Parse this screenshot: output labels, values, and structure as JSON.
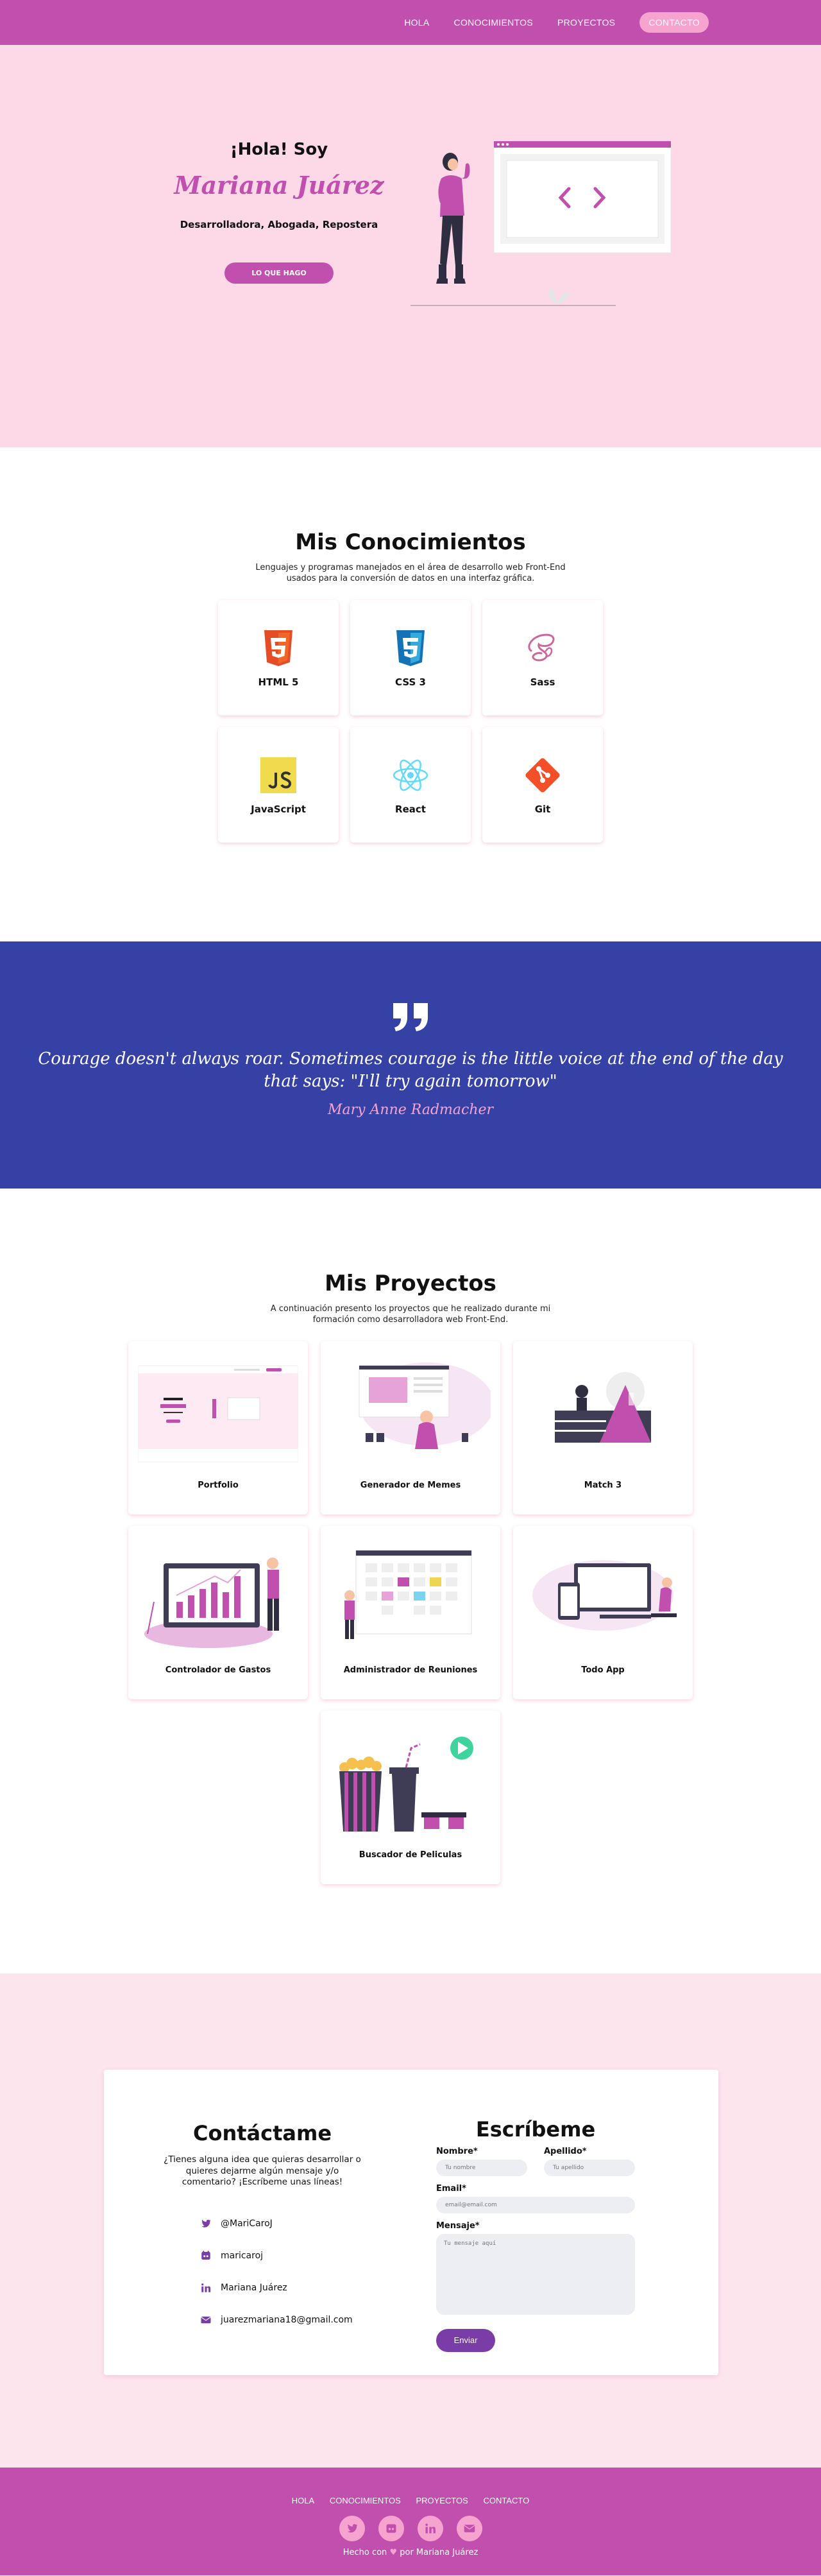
{
  "nav": {
    "items": [
      "Hola",
      "Conocimientos",
      "Proyectos",
      "Contacto"
    ]
  },
  "hero": {
    "greeting": "¡Hola! Soy",
    "name": "Mariana Juárez",
    "role": "Desarrolladora, Abogada, Repostera",
    "button": "LO QUE HAGO"
  },
  "skills": {
    "title": "Mis Conocimientos",
    "description": "Lenguajes y programas manejados en el área de desarrollo web Front-End usados para la conversión de datos en una interfaz gráfica.",
    "items": [
      {
        "label": "HTML 5",
        "icon": "html5-icon"
      },
      {
        "label": "CSS 3",
        "icon": "css3-icon"
      },
      {
        "label": "Sass",
        "icon": "sass-icon"
      },
      {
        "label": "JavaScript",
        "icon": "javascript-icon"
      },
      {
        "label": "React",
        "icon": "react-icon"
      },
      {
        "label": "Git",
        "icon": "git-icon"
      }
    ]
  },
  "quote": {
    "text": "Courage doesn't always roar. Sometimes courage is the little voice at the end of the day that says: \"I'll try again tomorrow\"",
    "author": "Mary Anne Radmacher"
  },
  "projects": {
    "title": "Mis Proyectos",
    "description": "A continuación presento los proyectos que he realizado durante mi formación como desarrolladora web Front-End.",
    "items": [
      {
        "label": "Portfolio"
      },
      {
        "label": "Generador de Memes"
      },
      {
        "label": "Match 3"
      },
      {
        "label": "Controlador de Gastos"
      },
      {
        "label": "Administrador de Reuniones"
      },
      {
        "label": "Todo App"
      },
      {
        "label": "Buscador de Peliculas"
      }
    ]
  },
  "contact": {
    "title": "Contáctame",
    "description": "¿Tienes alguna idea que quieras desarrollar o quieres dejarme algún mensaje y/o comentario? ¡Escríbeme unas líneas!",
    "links": [
      {
        "text": "@MariCaroJ",
        "icon": "twitter-icon"
      },
      {
        "text": "maricaroj",
        "icon": "github-icon"
      },
      {
        "text": "Mariana Juárez",
        "icon": "linkedin-icon"
      },
      {
        "text": "juarezmariana18@gmail.com",
        "icon": "mail-icon"
      }
    ]
  },
  "form": {
    "title": "Escríbeme",
    "nombre_label": "Nombre*",
    "nombre_placeholder": "Tu nombre",
    "apellido_label": "Apellido*",
    "apellido_placeholder": "Tu apellido",
    "email_label": "Email*",
    "email_placeholder": "email@email.com",
    "mensaje_label": "Mensaje*",
    "mensaje_placeholder": "Tu mensaje aquí",
    "submit": "Enviar"
  },
  "footer": {
    "links": [
      "Hola",
      "Conocimientos",
      "Proyectos",
      "Contacto"
    ],
    "made_prefix": "Hecho con",
    "heart": "♥",
    "made_suffix": "por Mariana Juárez"
  },
  "colors": {
    "brand": "#c04fae",
    "pink_light": "#fdd9e7",
    "accent": "#f7a3cf",
    "quote_bg": "#3641a5"
  }
}
